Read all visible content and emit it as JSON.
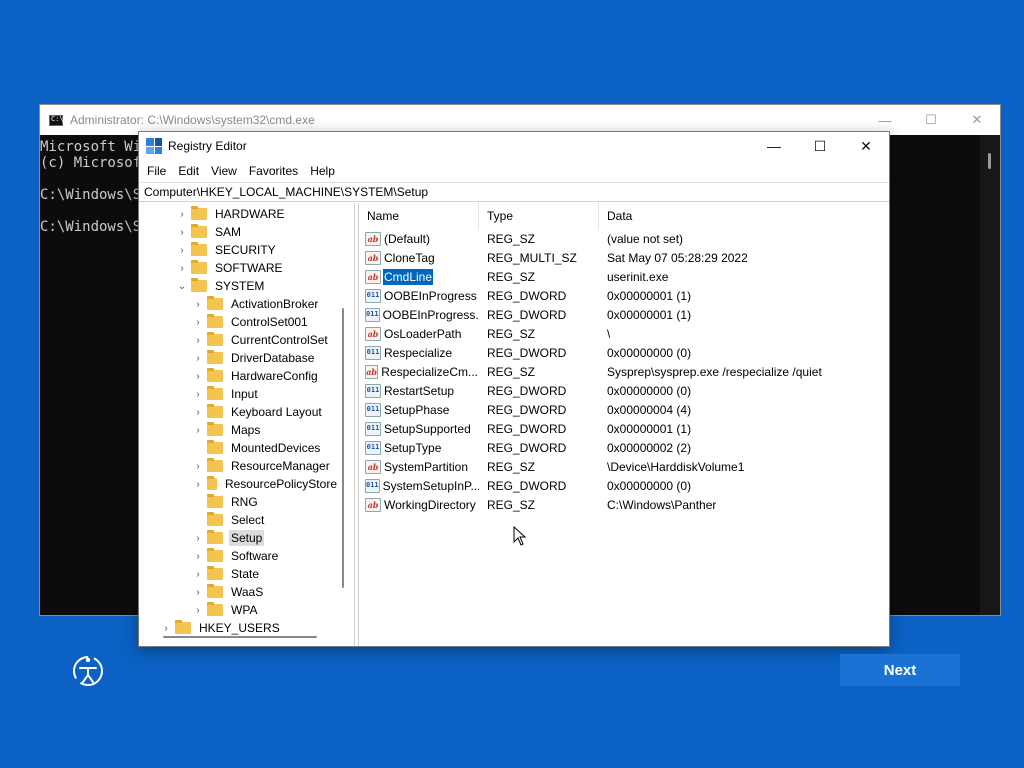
{
  "cmd": {
    "title": "Administrator: C:\\Windows\\system32\\cmd.exe",
    "lines": [
      "Microsoft Wi",
      "(c) Microsof",
      "",
      "C:\\Windows\\Sy",
      "",
      "C:\\Windows\\Sy"
    ],
    "controls": {
      "minimize": "—",
      "maximize": "☐",
      "close": "✕"
    }
  },
  "regedit": {
    "title": "Registry Editor",
    "controls": {
      "minimize": "—",
      "maximize": "☐",
      "close": "✕"
    },
    "menu": [
      "File",
      "Edit",
      "View",
      "Favorites",
      "Help"
    ],
    "address": "Computer\\HKEY_LOCAL_MACHINE\\SYSTEM\\Setup",
    "tree": [
      {
        "label": "HARDWARE",
        "level": 1,
        "chevron": "›"
      },
      {
        "label": "SAM",
        "level": 1,
        "chevron": "›"
      },
      {
        "label": "SECURITY",
        "level": 1,
        "chevron": "›"
      },
      {
        "label": "SOFTWARE",
        "level": 1,
        "chevron": "›"
      },
      {
        "label": "SYSTEM",
        "level": 1,
        "chevron": "⌄"
      },
      {
        "label": "ActivationBroker",
        "level": 2,
        "chevron": "›"
      },
      {
        "label": "ControlSet001",
        "level": 2,
        "chevron": "›"
      },
      {
        "label": "CurrentControlSet",
        "level": 2,
        "chevron": "›"
      },
      {
        "label": "DriverDatabase",
        "level": 2,
        "chevron": "›"
      },
      {
        "label": "HardwareConfig",
        "level": 2,
        "chevron": "›"
      },
      {
        "label": "Input",
        "level": 2,
        "chevron": "›"
      },
      {
        "label": "Keyboard Layout",
        "level": 2,
        "chevron": "›"
      },
      {
        "label": "Maps",
        "level": 2,
        "chevron": "›"
      },
      {
        "label": "MountedDevices",
        "level": 2,
        "chevron": ""
      },
      {
        "label": "ResourceManager",
        "level": 2,
        "chevron": "›"
      },
      {
        "label": "ResourcePolicyStore",
        "level": 2,
        "chevron": "›"
      },
      {
        "label": "RNG",
        "level": 2,
        "chevron": ""
      },
      {
        "label": "Select",
        "level": 2,
        "chevron": ""
      },
      {
        "label": "Setup",
        "level": 2,
        "chevron": "›",
        "selected": true
      },
      {
        "label": "Software",
        "level": 2,
        "chevron": "›"
      },
      {
        "label": "State",
        "level": 2,
        "chevron": "›"
      },
      {
        "label": "WaaS",
        "level": 2,
        "chevron": "›"
      },
      {
        "label": "WPA",
        "level": 2,
        "chevron": "›"
      },
      {
        "label": "HKEY_USERS",
        "level": 0,
        "chevron": "›"
      }
    ],
    "columns": {
      "name": "Name",
      "type": "Type",
      "data": "Data"
    },
    "values": [
      {
        "name": "(Default)",
        "type": "REG_SZ",
        "data": "(value not set)",
        "icon": "sz"
      },
      {
        "name": "CloneTag",
        "type": "REG_MULTI_SZ",
        "data": "Sat May 07 05:28:29 2022",
        "icon": "sz"
      },
      {
        "name": "CmdLine",
        "type": "REG_SZ",
        "data": "userinit.exe",
        "icon": "sz",
        "selected": true
      },
      {
        "name": "OOBEInProgress",
        "type": "REG_DWORD",
        "data": "0x00000001 (1)",
        "icon": "bin"
      },
      {
        "name": "OOBEInProgress...",
        "type": "REG_DWORD",
        "data": "0x00000001 (1)",
        "icon": "bin"
      },
      {
        "name": "OsLoaderPath",
        "type": "REG_SZ",
        "data": "\\",
        "icon": "sz"
      },
      {
        "name": "Respecialize",
        "type": "REG_DWORD",
        "data": "0x00000000 (0)",
        "icon": "bin"
      },
      {
        "name": "RespecializeCm...",
        "type": "REG_SZ",
        "data": "Sysprep\\sysprep.exe /respecialize /quiet",
        "icon": "sz"
      },
      {
        "name": "RestartSetup",
        "type": "REG_DWORD",
        "data": "0x00000000 (0)",
        "icon": "bin"
      },
      {
        "name": "SetupPhase",
        "type": "REG_DWORD",
        "data": "0x00000004 (4)",
        "icon": "bin"
      },
      {
        "name": "SetupSupported",
        "type": "REG_DWORD",
        "data": "0x00000001 (1)",
        "icon": "bin"
      },
      {
        "name": "SetupType",
        "type": "REG_DWORD",
        "data": "0x00000002 (2)",
        "icon": "bin"
      },
      {
        "name": "SystemPartition",
        "type": "REG_SZ",
        "data": "\\Device\\HarddiskVolume1",
        "icon": "sz"
      },
      {
        "name": "SystemSetupInP...",
        "type": "REG_DWORD",
        "data": "0x00000000 (0)",
        "icon": "bin"
      },
      {
        "name": "WorkingDirectory",
        "type": "REG_SZ",
        "data": "C:\\Windows\\Panther",
        "icon": "sz"
      }
    ],
    "icon_labels": {
      "sz": "ab",
      "bin": "011"
    }
  },
  "setup": {
    "next_label": "Next",
    "accessibility_icon": "accessibility-icon"
  },
  "colors": {
    "desktop": "#0b62c4",
    "selection": "#0067c0",
    "next_button": "#1a73d4"
  }
}
